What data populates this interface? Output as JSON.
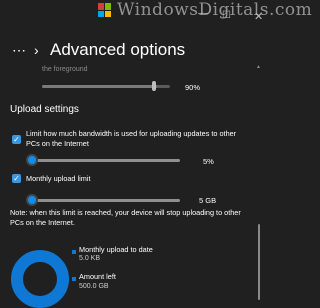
{
  "window": {
    "watermark": "WindowsDigitals.com",
    "controls": {
      "minimize": "—",
      "maximize": "☐",
      "close": "✕"
    }
  },
  "header": {
    "menu_icon": "⋯",
    "chevron": "›",
    "title": "Advanced options"
  },
  "foreground": {
    "faded_label": "the foreground",
    "value_label": "90%",
    "level_percent": 90
  },
  "upload": {
    "section_title": "Upload settings",
    "limit_bandwidth": {
      "checked": true,
      "label_line1": "Limit how much bandwidth is used for uploading updates to other",
      "label_line2": "PCs on the Internet",
      "value_label": "5%",
      "level_percent": 5
    },
    "monthly_limit": {
      "checked": true,
      "label": "Monthly upload limit",
      "value_label": "5 GB"
    },
    "note_line1": "Note: when this limit is reached, your device will stop uploading to other",
    "note_line2": "PCs on the Internet.",
    "usage": {
      "uploaded_title": "Monthly upload to date",
      "uploaded_value": "5.0 KB",
      "left_title": "Amount left",
      "left_value": "500.0 GB"
    }
  },
  "colors": {
    "accent": "#0e8ff0",
    "background": "#202020",
    "checkbox": "#3a96dd",
    "ring": "#0f78d4"
  },
  "icons": {
    "check": "✓"
  }
}
